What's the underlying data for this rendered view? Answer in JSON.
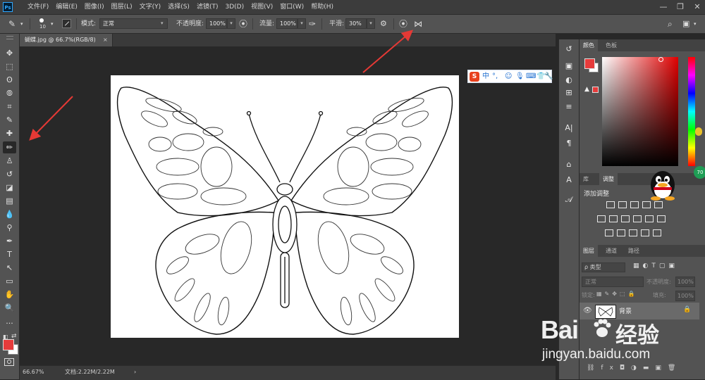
{
  "app": {
    "logo": "Ps"
  },
  "menu": [
    "文件(F)",
    "编辑(E)",
    "图像(I)",
    "图层(L)",
    "文字(Y)",
    "选择(S)",
    "滤镜(T)",
    "3D(D)",
    "视图(V)",
    "窗口(W)",
    "帮助(H)"
  ],
  "window_controls": [
    "minimize-icon",
    "restore-icon",
    "close-icon"
  ],
  "options": {
    "brush_size": "10",
    "mode_label": "模式:",
    "mode_value": "正常",
    "opacity_label": "不透明度:",
    "opacity_value": "100%",
    "flow_label": "流量:",
    "flow_value": "100%",
    "smooth_label": "平滑:",
    "smooth_value": "30%"
  },
  "document": {
    "tab_title": "蝴蝶.jpg @ 66.7%(RGB/8)",
    "tab_close": "×",
    "zoom": "66.67%",
    "doc_info": "文档:2.22M/2.22M",
    "status_arrow": "›"
  },
  "tools": [
    "move-icon",
    "marquee-icon",
    "lasso-icon",
    "quick-select-icon",
    "crop-icon",
    "eyedropper-icon",
    "healing-brush-icon",
    "brush-icon",
    "stamp-icon",
    "history-brush-icon",
    "eraser-icon",
    "gradient-icon",
    "blur-icon",
    "dodge-icon",
    "pen-icon",
    "type-icon",
    "path-select-icon",
    "rectangle-icon",
    "hand-icon",
    "zoom-icon",
    "more-icon"
  ],
  "tool_glyphs": [
    "✥",
    "⬚",
    "ʘ",
    "⦾",
    "⌗",
    "✎",
    "✚",
    "✏",
    "♙",
    "↺",
    "◪",
    "▤",
    "💧",
    "⚲",
    "✒",
    "T",
    "↖",
    "▭",
    "✋",
    "🔍",
    "···"
  ],
  "active_tool": "brush-icon",
  "colors": {
    "foreground": "#e63b3b",
    "background": "#ffffff",
    "accent_red": "#e63b3b"
  },
  "color_panel": {
    "tabs": [
      "颜色",
      "色板"
    ],
    "active": "颜色"
  },
  "adjust_panel": {
    "tabs": [
      "库",
      "调整"
    ],
    "active": "调整",
    "title": "添加调整"
  },
  "layers_panel": {
    "tabs": [
      "图层",
      "通道",
      "路径"
    ],
    "active": "图层",
    "filter_label": "ρ 类型",
    "blend_mode": "正常",
    "opacity_label": "不透明度:",
    "opacity_value": "100%",
    "lock_label": "锁定:",
    "fill_label": "填充:",
    "fill_value": "100%",
    "layer_name": "背景"
  },
  "right_strip_glyphs": [
    "↺",
    "▣",
    "◐",
    "⊞",
    "≡",
    "A|",
    "¶",
    "⌂",
    "A",
    "𝒜"
  ],
  "sogou": {
    "logo": "S",
    "mode": "中",
    "punct": "°,",
    "icons": [
      "☺",
      "🎤",
      "⌨",
      "👕",
      "🔧"
    ]
  },
  "overlay": {
    "badge": "70"
  },
  "watermark": {
    "brand_a": "Bai",
    "brand_b": "经验",
    "url": "jingyan.baidu.com"
  }
}
